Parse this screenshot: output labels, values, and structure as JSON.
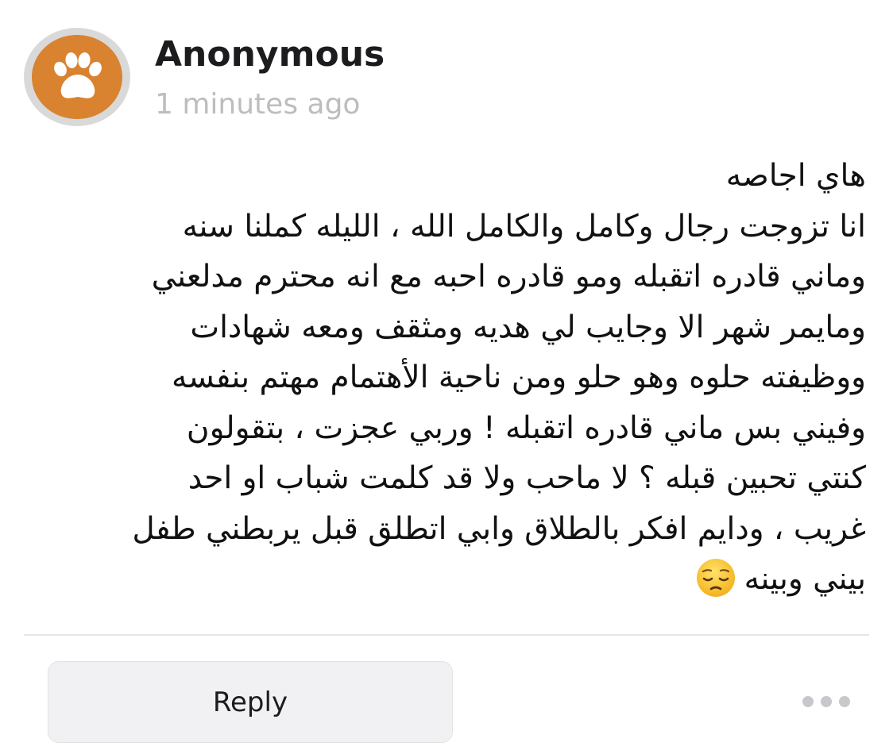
{
  "post": {
    "author": "Anonymous",
    "timestamp": "1 minutes ago",
    "avatar_icon": "paw-icon",
    "avatar_color": "#d9822f",
    "message_lines": [
      "هاي اجاصه",
      "انا تزوجت رجال وكامل والكامل الله ، الليله كملنا سنه",
      "وماني قادره اتقبله ومو قادره احبه مع انه محترم  مدلعني",
      "ومايمر شهر الا وجايب لي هديه ومثقف ومعه شهادات",
      "ووظيفته حلوه وهو حلو ومن ناحية الأهتمام مهتم بنفسه",
      "وفيني بس  ماني قادره اتقبله ! وربي عجزت ، بتقولون",
      "كنتي تحبين قبله ؟ لا ماحب ولا قد كلمت شباب او احد",
      "غريب ، ودايم افكر بالطلاق وابي اتطلق قبل يربطني طفل",
      "بيني وبينه"
    ],
    "end_emoji": "pensive-face-emoji"
  },
  "actions": {
    "reply_label": "Reply",
    "more_icon": "more-dots-icon"
  }
}
